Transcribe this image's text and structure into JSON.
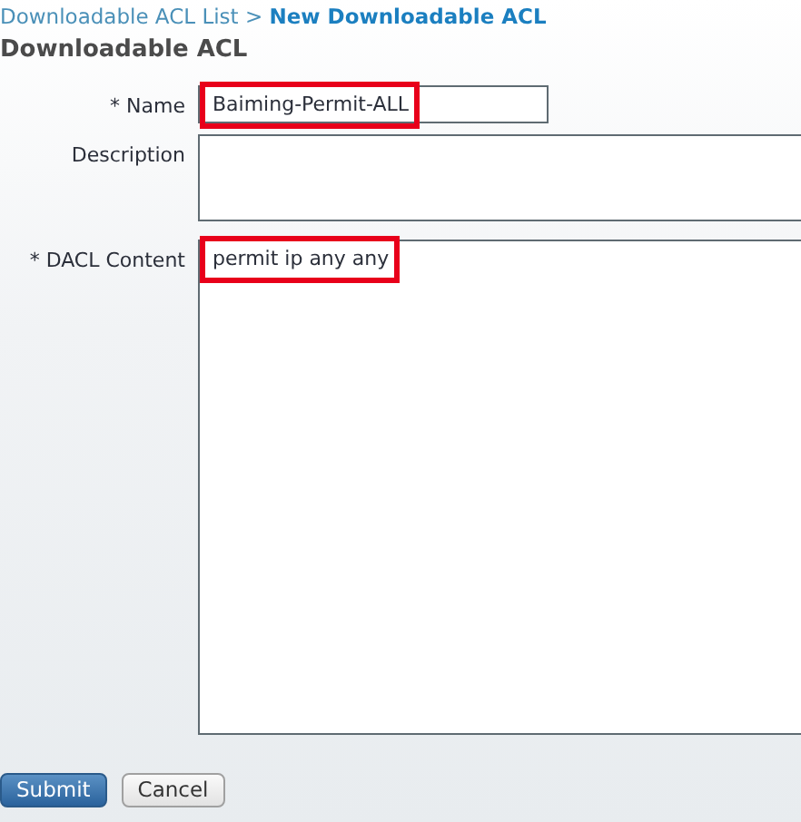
{
  "breadcrumb": {
    "parent": "Downloadable ACL List",
    "separator": ">",
    "current": "New Downloadable ACL"
  },
  "title": "Downloadable ACL",
  "fields": [
    {
      "label": "* Name",
      "kind": "input",
      "value": "Baiming-Permit-ALL",
      "highlighted": true
    },
    {
      "label": "Description",
      "kind": "textarea-short"
    },
    {
      "label": "* DACL Content",
      "kind": "textarea-tall",
      "value": "permit ip any any",
      "highlighted": true
    }
  ],
  "buttons": [
    {
      "label": "Submit",
      "kind": "primary"
    },
    {
      "label": "Cancel",
      "kind": "secondary"
    }
  ]
}
